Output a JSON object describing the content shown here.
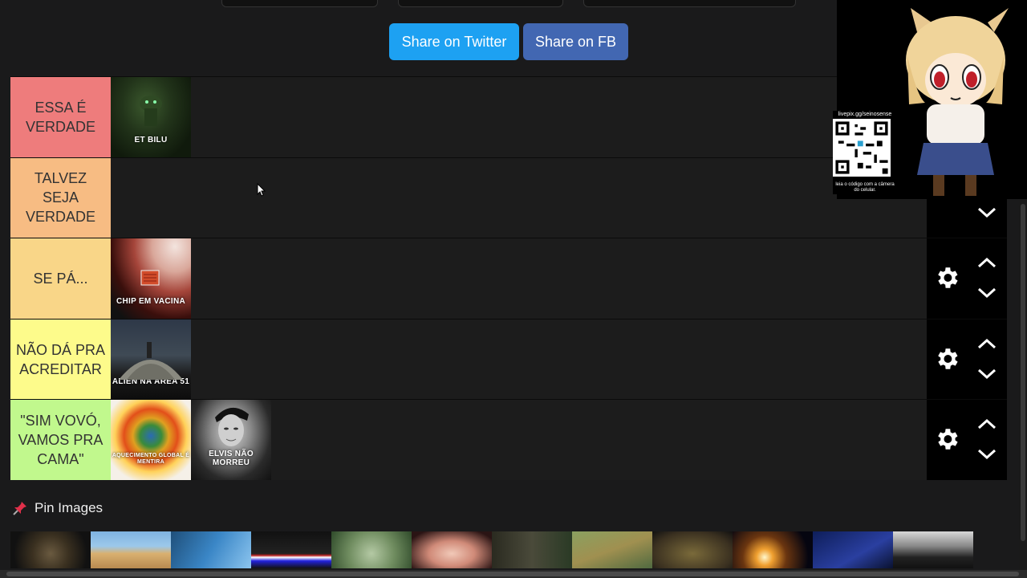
{
  "share": {
    "twitter_label": "Share on Twitter",
    "fb_label": "Share on FB"
  },
  "tiers": [
    {
      "label": "ESSA É VERDADE",
      "color": "#ee7c7c",
      "items": [
        {
          "caption": "ET BILU"
        }
      ]
    },
    {
      "label": "TALVEZ SEJA VERDADE",
      "color": "#f7bc83",
      "items": []
    },
    {
      "label": "SE PÁ...",
      "color": "#f9d688",
      "items": [
        {
          "caption": "CHIP EM VACINA"
        }
      ]
    },
    {
      "label": "NÃO DÁ PRA ACREDITAR",
      "color": "#fdfb8b",
      "items": [
        {
          "caption": "ALIEN NA ÁREA 51"
        }
      ]
    },
    {
      "label": "\"SIM VOVÓ, VAMOS PRA CAMA\"",
      "color": "#c1f88d",
      "items": [
        {
          "caption": "AQUECIMENTO GLOBAL É MENTIRA"
        },
        {
          "caption": "ELVIS NÃO MORREU"
        }
      ]
    }
  ],
  "pin": {
    "title": "Pin Images",
    "icon": "pushpin-icon"
  },
  "overlay": {
    "qr_url": "livepix.gg/seinosense",
    "qr_caption": "leia o código com a câmera do celular."
  }
}
